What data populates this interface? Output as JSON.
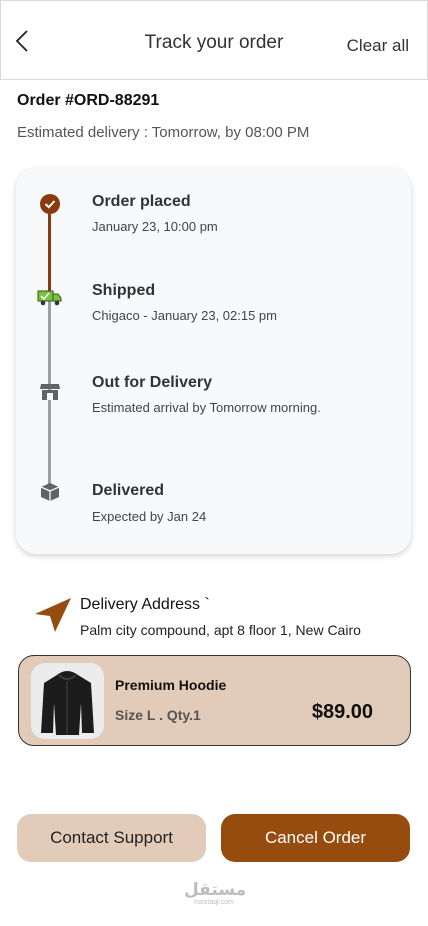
{
  "header": {
    "title": "Track your order",
    "clear_label": "Clear all"
  },
  "order": {
    "id": "Order #ORD-88291",
    "estimated": "Estimated delivery : Tomorrow, by 08:00 PM"
  },
  "timeline": [
    {
      "title": "Order placed",
      "subtitle": "January 23, 10:00 pm",
      "icon": "check-circle-icon",
      "status": "done"
    },
    {
      "title": "Shipped",
      "subtitle": "Chigaco - January 23, 02:15 pm",
      "icon": "delivery-truck-icon",
      "status": "done"
    },
    {
      "title": "Out for Delivery",
      "subtitle": "Estimated arrival by Tomorrow morning.",
      "icon": "store-icon",
      "status": "pending"
    },
    {
      "title": "Delivered",
      "subtitle": "Expected by Jan 24",
      "icon": "package-icon",
      "status": "pending"
    }
  ],
  "address": {
    "label": "Delivery Address `",
    "text": "Palm city compound, apt 8 floor 1, New Cairo"
  },
  "product": {
    "name": "Premium Hoodie",
    "meta": "Size L . Qty.1",
    "price": "$89.00"
  },
  "actions": {
    "support_label": "Contact Support",
    "cancel_label": "Cancel Order"
  },
  "watermark": {
    "main": "مستقل",
    "sub": "mostaql.com"
  },
  "colors": {
    "accent": "#974c0f",
    "timeline_done": "#8a3b0d",
    "timeline_pending": "#9aa0a6",
    "beige": "#e2ccb9",
    "truck_green": "#7cc242"
  }
}
